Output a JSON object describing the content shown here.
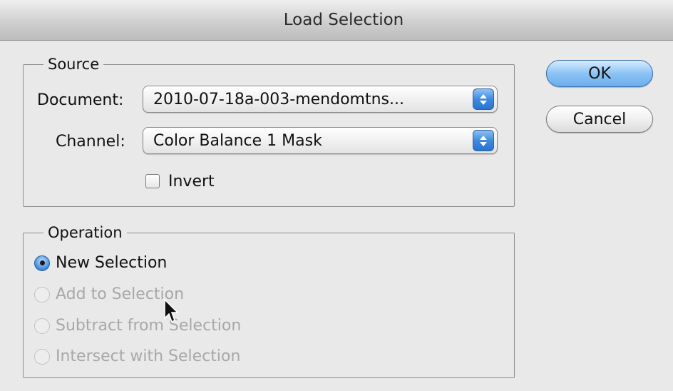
{
  "dialog": {
    "title": "Load Selection"
  },
  "source": {
    "legend": "Source",
    "document_label": "Document:",
    "document_value": "2010-07-18a-003-mendomtns...",
    "channel_label": "Channel:",
    "channel_value": "Color Balance 1 Mask",
    "invert_label": "Invert",
    "invert_checked": false
  },
  "operation": {
    "legend": "Operation",
    "options": [
      {
        "label": "New Selection",
        "selected": true,
        "enabled": true
      },
      {
        "label": "Add to Selection",
        "selected": false,
        "enabled": false
      },
      {
        "label": "Subtract from Selection",
        "selected": false,
        "enabled": false
      },
      {
        "label": "Intersect with Selection",
        "selected": false,
        "enabled": false
      }
    ]
  },
  "buttons": {
    "ok": "OK",
    "cancel": "Cancel"
  },
  "icons": {
    "popup_stepper": "up-down-arrows-icon",
    "cursor": "mouse-pointer-icon"
  },
  "colors": {
    "accent_blue": "#3f8ae0",
    "disabled_text": "#a8a8a8"
  }
}
